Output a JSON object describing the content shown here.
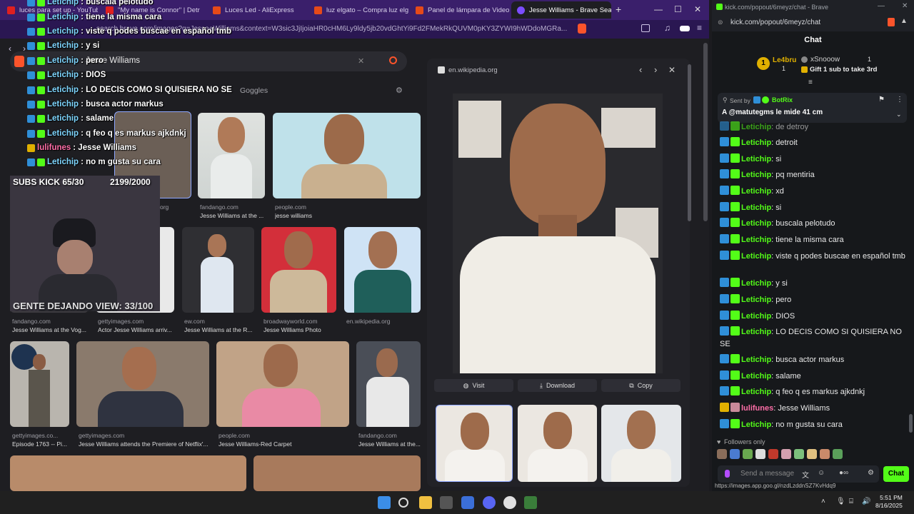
{
  "browser": {
    "tabs": [
      {
        "label": "luces para set up - YouTube",
        "fav": "#e02020"
      },
      {
        "label": "\"My name is Connor\" | Detroit",
        "fav": "#e02020"
      },
      {
        "label": "Luces Led - AliExpress",
        "fav": "#e64a19"
      },
      {
        "label": "luz elgato – Compra luz elgato",
        "fav": "#e64a19"
      },
      {
        "label": "Panel de lámpara de Video Le",
        "fav": "#e64a19"
      },
      {
        "label": "Jesse Williams - Brave Sea",
        "fav": "#7c4dff"
      }
    ],
    "url": "search.brave.com/images?q=Jesse+Williams&context=W3sic3JjIjoiaHR0cHM6Ly9ldy5jb20vdGhtYi9Fd2FMekRkQUVM0pKY3ZYWI9hWDdoMGRa...",
    "search_query": "Jesse Williams",
    "search_tabs": [
      "s",
      "Goggles"
    ]
  },
  "results": [
    {
      "src": "org",
      "caption": ""
    },
    {
      "src": "fandango.com",
      "caption": "Jesse Williams at the ..."
    },
    {
      "src": "people.com",
      "caption": "jesse williams"
    },
    {
      "src": "fandango.com",
      "caption": "Jesse Williams at the Vog..."
    },
    {
      "src": "gettyimages.com",
      "caption": "Actor Jesse Williams arriv..."
    },
    {
      "src": "ew.com",
      "caption": "Jesse Williams at the R..."
    },
    {
      "src": "broadwayworld.com",
      "caption": "Jesse Williams Photo"
    },
    {
      "src": "en.wikipedia.org",
      "caption": ""
    },
    {
      "src": "gettyimages.co...",
      "caption": "Episode 1763 -- Pi..."
    },
    {
      "src": "gettyimages.com",
      "caption": "Jesse Williams attends the Premiere of Netflix'..."
    },
    {
      "src": "people.com",
      "caption": "Jesse Williams-Red Carpet"
    },
    {
      "src": "fandango.com",
      "caption": "Jesse Williams at the..."
    }
  ],
  "preview": {
    "source": "en.wikipedia.org",
    "visit": "Visit",
    "download": "Download",
    "copy": "Copy"
  },
  "overlay": {
    "lines": [
      {
        "user": "Letichip",
        "text": ": buscala pelotudo"
      },
      {
        "user": "Letichip",
        "text": ": tiene la misma cara"
      },
      {
        "user": "Letichip",
        "text": ": viste q podes buscae en español tmb"
      },
      {
        "user": "Letichip",
        "text": ": y si"
      },
      {
        "user": "Letichip",
        "text": ": pero"
      },
      {
        "user": "Letichip",
        "text": ": DIOS"
      },
      {
        "user": "Letichip",
        "text": ": LO DECIS COMO SI QUISIERA NO SE"
      },
      {
        "user": "Letichip",
        "text": ": busca actor markus"
      },
      {
        "user": "Letichip",
        "text": ": salame"
      },
      {
        "user": "Letichip",
        "text": ": q feo q es markus ajkdnkj"
      },
      {
        "user": "lulifunes",
        "text": ": Jesse Williams"
      },
      {
        "user": "Letichip",
        "text": ": no m gusta su cara"
      }
    ],
    "subs": "SUBS KICK 65/30",
    "subs_count": "2199/2000",
    "goal": "GENTE DEJANDO VIEW: 33/100"
  },
  "kick": {
    "window_title": "kick.com/popout/6meyz/chat - Brave",
    "url": "kick.com/popout/6meyz/chat",
    "header": "Chat",
    "leaders": [
      {
        "name": "Le4bru",
        "count": "1"
      },
      {
        "name": "xSnooow",
        "count": "1"
      }
    ],
    "gift_text": "Gift 1 sub to take 3rd",
    "pinned_sender_prefix": "Sent by",
    "pinned_sender": "BotRix",
    "pinned_text": "A @matutegms le mide 41 cm",
    "messages": [
      {
        "user": "Letichip",
        "text": ": de detroy"
      },
      {
        "user": "Letichip",
        "text": ": detroit"
      },
      {
        "user": "Letichip",
        "text": ": si"
      },
      {
        "user": "Letichip",
        "text": ": pq mentiria"
      },
      {
        "user": "Letichip",
        "text": ": xd"
      },
      {
        "user": "Letichip",
        "text": ": si"
      },
      {
        "user": "Letichip",
        "text": ": buscala pelotudo"
      },
      {
        "user": "Letichip",
        "text": ": tiene la misma cara"
      },
      {
        "user": "Letichip",
        "text": ": viste q podes buscae en español tmb"
      },
      {
        "user": "Letichip",
        "text": ": y si"
      },
      {
        "user": "Letichip",
        "text": ": pero"
      },
      {
        "user": "Letichip",
        "text": ": DIOS"
      },
      {
        "user": "Letichip",
        "text": ": LO DECIS COMO SI QUISIERA NO SE"
      },
      {
        "user": "Letichip",
        "text": ": busca actor markus"
      },
      {
        "user": "Letichip",
        "text": ": salame"
      },
      {
        "user": "Letichip",
        "text": ": q feo q es markus ajkdnkj"
      },
      {
        "user": "lulifunes",
        "text": ": Jesse Williams"
      },
      {
        "user": "Letichip",
        "text": ": no m gusta su cara"
      }
    ],
    "followers_only": "Followers only",
    "input_placeholder": "Send a message",
    "chat_button": "Chat",
    "status_url": "https://images.app.goo.gl/nzdLzddnSZ7KvHdq9"
  },
  "taskbar": {
    "time": "5:51 PM",
    "date": "8/16/2025"
  },
  "colors": {
    "brand_green": "#53fc18",
    "brave_purple": "#3a1f6b"
  }
}
